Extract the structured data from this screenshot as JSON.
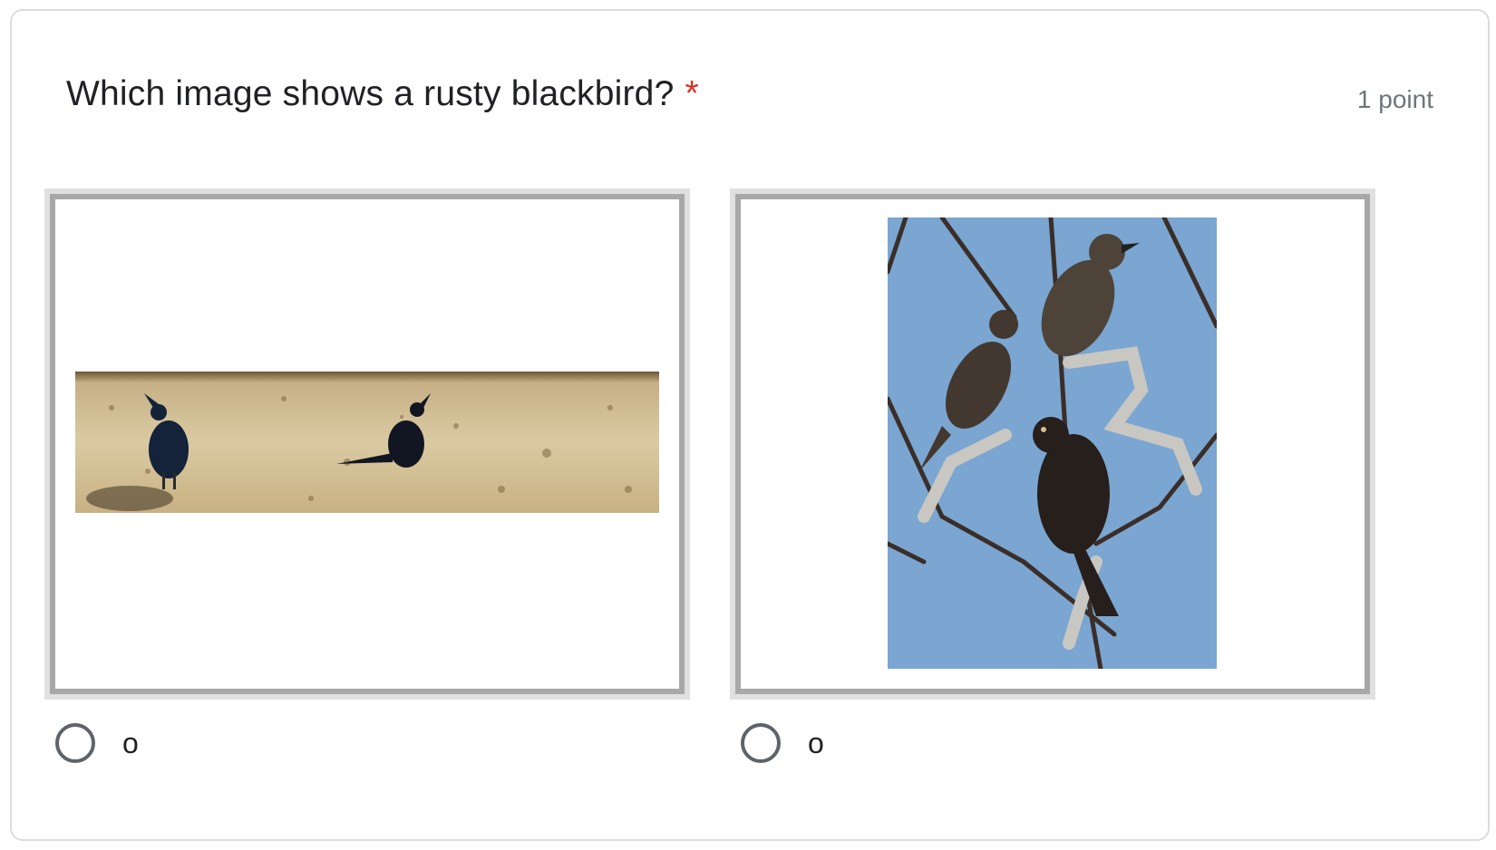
{
  "question": {
    "title": "Which image shows a rusty blackbird?",
    "required_marker": "*",
    "points": "1 point"
  },
  "options": [
    {
      "label": "o",
      "image": "two-grackles-on-sand-photo"
    },
    {
      "label": "o",
      "image": "three-blackbirds-in-tree-photo"
    }
  ],
  "colors": {
    "required": "#d93025",
    "title": "#202124",
    "points": "#70757a",
    "card_border": "#dadce0",
    "radio_border": "#5f6368"
  }
}
